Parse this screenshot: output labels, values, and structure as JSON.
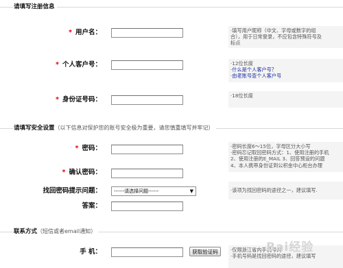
{
  "sections": {
    "register": {
      "title": "请填写注册信息"
    },
    "security": {
      "title": "请填写安全设置",
      "note": "（以下信息对保护您的账号安全极为重要，请您慎重填写并牢记）"
    },
    "contact": {
      "title": "联系方式",
      "note": "（短信或者email通知）"
    }
  },
  "fields": {
    "username": {
      "required": "*",
      "label": "用户名：",
      "hint": [
        "·填写用户昵称（中文、字母或数字的组",
        "合），用于日常登录，不应包含特殊符号及",
        "标点"
      ]
    },
    "customer_id": {
      "required": "*",
      "label": "个人客户号：",
      "hint": [
        "·12位长度"
      ],
      "links": [
        "·什么是个人客户号？",
        "·由老账号查个人客户号"
      ]
    },
    "id_number": {
      "required": "*",
      "label": "身份证号码：",
      "hint": [
        "·18位长度"
      ]
    },
    "password": {
      "required": "*",
      "label": "密码：",
      "hint": [
        "·密码长度6～15位，字母区分大小写",
        "·密码忘记取回密码方式：1、使用注册的手机",
        "2、使用注册的E_MAIL 3、回答预设的问题",
        "4、本人携带身份证到公积金中心柜台办理"
      ]
    },
    "confirm_password": {
      "required": "*",
      "label": "确认密码："
    },
    "recovery_question": {
      "label": "找回密码提示问题：",
      "selected": "------请选择问题------",
      "hint": [
        "·该项为找回密码的途径之一，建议填写."
      ]
    },
    "answer": {
      "label": "答案："
    },
    "phone": {
      "label": "手 机：",
      "button": "获取验证码",
      "hint": [
        "·仅限浙江省内手机号码",
        "·手机号码是找回密码的途径，建议填写"
      ]
    }
  },
  "watermark": "Bai经验"
}
